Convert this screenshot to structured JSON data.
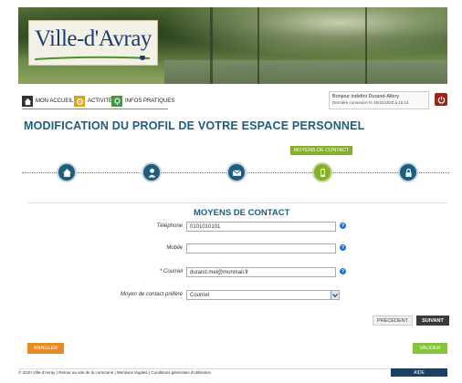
{
  "banner": {
    "logo_text": "Ville-d'Avray"
  },
  "nav": {
    "items": [
      {
        "label": "MON ACCUEIL",
        "icon": "home-icon",
        "color": "#333333"
      },
      {
        "label": "ACTIVITÉS",
        "icon": "activities-icon",
        "color": "#e0a020"
      },
      {
        "label": "INFOS PRATIQUES",
        "icon": "info-icon",
        "color": "#3d9a3d"
      }
    ]
  },
  "user": {
    "greeting": "Bonjour indefini Durand-Allery",
    "last_login": "Dernière connexion le 18/11/2020 à 15:14"
  },
  "page_title": "MODIFICATION DU PROFIL DE VOTRE ESPACE PERSONNEL",
  "steps": {
    "current_label": "MOYENS DE CONTACT",
    "items": [
      {
        "icon": "home-icon",
        "active": false
      },
      {
        "icon": "user-icon",
        "active": false
      },
      {
        "icon": "envelope-icon",
        "active": false
      },
      {
        "icon": "phone-icon",
        "active": true
      },
      {
        "icon": "lock-icon",
        "active": false
      }
    ]
  },
  "form": {
    "section_title": "MOYENS DE CONTACT",
    "telephone": {
      "label": "Téléphone",
      "value": "0101010101"
    },
    "mobile": {
      "label": "Mobile",
      "value": ""
    },
    "email": {
      "label": "* Courriel",
      "value": "durand.mel@monmail.fr"
    },
    "preferred": {
      "label": "Moyen de contact préféré",
      "value": "Courriel"
    }
  },
  "buttons": {
    "previous": "PRÉCÉDENT",
    "next": "SUIVANT",
    "cancel": "ANNULER",
    "validate": "VALIDER"
  },
  "footer": {
    "text": "© 2020 Ville-d'Avray | Retour au site de la commune | Mentions légales | Conditions générales d'utilisation",
    "help": "AIDE"
  },
  "colors": {
    "primary": "#1c5e80",
    "accent_green": "#86b02b",
    "cancel_orange": "#e88b25",
    "logout_red": "#a3231c"
  }
}
